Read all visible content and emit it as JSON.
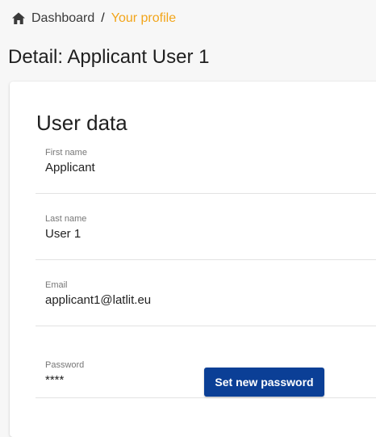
{
  "breadcrumb": {
    "home_icon": "home-icon",
    "dashboard_label": "Dashboard",
    "separator": "/",
    "current_label": "Your profile",
    "current_color": "#f2a51a"
  },
  "page": {
    "title": "Detail: Applicant User 1"
  },
  "user_data": {
    "section_title": "User data",
    "fields": [
      {
        "label": "First name",
        "value": "Applicant"
      },
      {
        "label": "Last name",
        "value": "User 1"
      },
      {
        "label": "Email",
        "value": "applicant1@latlit.eu"
      },
      {
        "label": "Password",
        "value": "****"
      }
    ],
    "set_password_label": "Set new password",
    "button_color": "#0b3f96"
  }
}
